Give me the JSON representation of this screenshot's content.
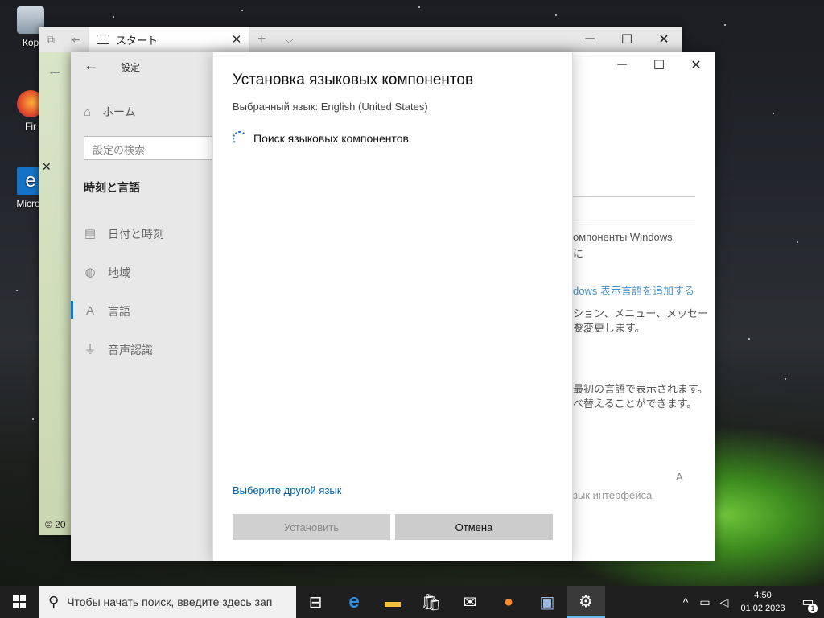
{
  "desktop": {
    "icons": [
      {
        "label": "Кор",
        "icon": "recycle-bin-icon"
      },
      {
        "label": "Fir",
        "icon": "firefox-icon"
      },
      {
        "label": "Micros",
        "icon": "edge-icon"
      }
    ]
  },
  "edge_window": {
    "tab_title": "スタート",
    "footer_text": "© 20"
  },
  "settings": {
    "title": "設定",
    "home_label": "ホーム",
    "search_placeholder": "設定の検索",
    "section_title": "時刻と言語",
    "nav": [
      {
        "label": "日付と時刻",
        "icon": "calendar-clock-icon"
      },
      {
        "label": "地域",
        "icon": "globe-icon"
      },
      {
        "label": "言語",
        "icon": "language-icon"
      },
      {
        "label": "音声認識",
        "icon": "microphone-icon"
      }
    ],
    "background_text": {
      "line1": "омпоненты Windows,",
      "line2": "に",
      "link": "dows 表示言語を追加する",
      "line3": "ション、メニュー、メッセージ、",
      "line4": "を変更します。",
      "line5": "最初の言語で表示されます。",
      "line6": "べ替えることができます。",
      "line7": "зык интерфейса"
    }
  },
  "dialog": {
    "title": "Установка языковых компонентов",
    "selected_language": "Выбранный язык: English (United States)",
    "status": "Поиск языковых компонентов",
    "choose_other_link": "Выберите другой язык",
    "install_button": "Установить",
    "cancel_button": "Отмена"
  },
  "taskbar": {
    "search_placeholder": "Чтобы начать поиск, введите здесь зап",
    "time": "4:50",
    "date": "01.02.2023",
    "notification_count": "1"
  }
}
